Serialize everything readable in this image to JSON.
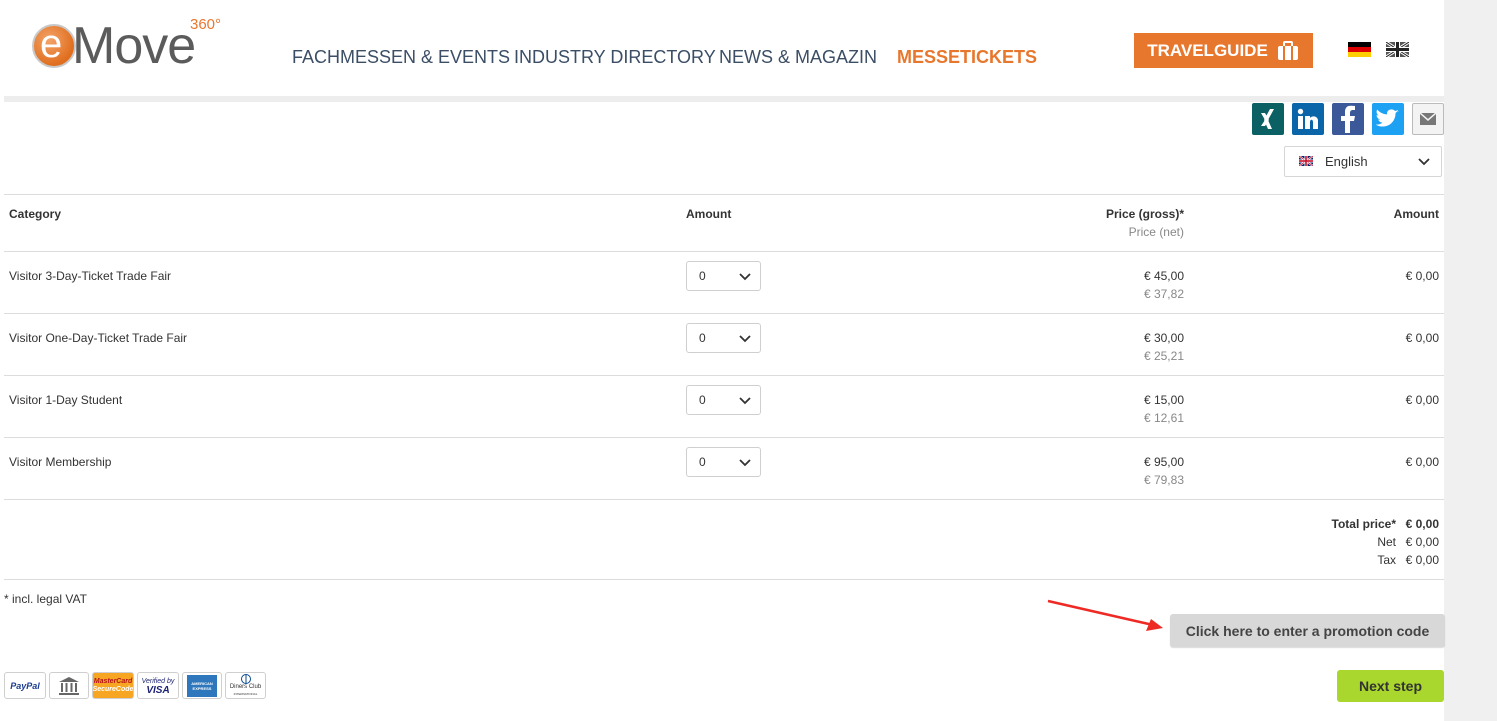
{
  "logo": {
    "main": "Move",
    "letter": "e",
    "sup": "360°"
  },
  "nav": [
    "FACHMESSEN & EVENTS",
    "INDUSTRY DIRECTORY",
    "NEWS & MAGAZIN",
    "MESSETICKETS"
  ],
  "travelguide": "TRAVELGUIDE",
  "language": {
    "selected": "English"
  },
  "table": {
    "headers": {
      "category": "Category",
      "amount": "Amount",
      "price_gross": "Price (gross)*",
      "price_net": "Price (net)",
      "total_amount": "Amount"
    },
    "rows": [
      {
        "category": "Visitor 3-Day-Ticket Trade Fair",
        "qty": "0",
        "gross": "€ 45,00",
        "net": "€ 37,82",
        "amount": "€ 0,00"
      },
      {
        "category": "Visitor One-Day-Ticket Trade Fair",
        "qty": "0",
        "gross": "€ 30,00",
        "net": "€ 25,21",
        "amount": "€ 0,00"
      },
      {
        "category": "Visitor 1-Day Student",
        "qty": "0",
        "gross": "€ 15,00",
        "net": "€ 12,61",
        "amount": "€ 0,00"
      },
      {
        "category": "Visitor Membership",
        "qty": "0",
        "gross": "€ 95,00",
        "net": "€ 79,83",
        "amount": "€ 0,00"
      }
    ]
  },
  "totals": {
    "total_label": "Total price*",
    "total_value": "€ 0,00",
    "net_label": "Net",
    "net_value": "€ 0,00",
    "tax_label": "Tax",
    "tax_value": "€ 0,00"
  },
  "vat_note": "* incl. legal VAT",
  "promo_button": "Click here to enter a promotion code",
  "next_button": "Next step",
  "payments": {
    "paypal": "PayPal",
    "mastercard_1": "MasterCard",
    "mastercard_2": "SecureCode",
    "visa_1": "Verified by",
    "visa_2": "VISA",
    "amex": "AMERICAN EXPRESS",
    "diners_1": "Diners Club",
    "diners_2": "INTERNATIONAL"
  }
}
